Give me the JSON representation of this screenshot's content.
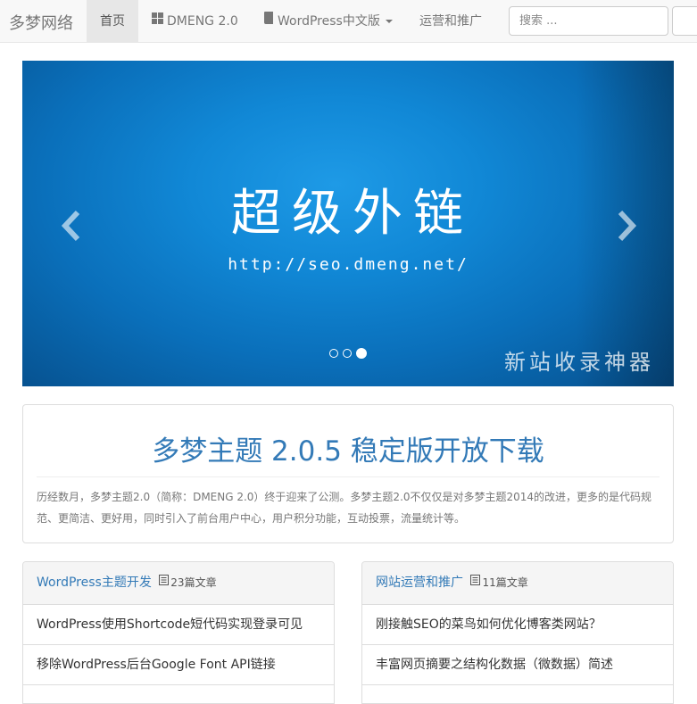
{
  "navbar": {
    "brand": "多梦网络",
    "items": [
      {
        "label": "首页",
        "icon": "none"
      },
      {
        "label": "DMENG 2.0",
        "icon": "th-large-icon"
      },
      {
        "label": "WordPress中文版",
        "icon": "book-icon"
      },
      {
        "label": "运营和推广",
        "icon": "none"
      }
    ],
    "search_placeholder": "搜索 ..."
  },
  "carousel": {
    "title": "超级外链",
    "subtitle": "http://seo.dmeng.net/",
    "caption": "新站收录神器",
    "slide_count": 3,
    "active_slide": 3
  },
  "notice": {
    "title": "多梦主题 2.0.5 稳定版开放下载",
    "text": "历经数月，多梦主题2.0（简称：DMENG 2.0）终于迎来了公测。多梦主题2.0不仅仅是对多梦主题2014的改进，更多的是代码规范、更简洁、更好用，同时引入了前台用户中心，用户积分功能，互动投票，流量统计等。"
  },
  "categories": [
    {
      "name": "WordPress主题开发",
      "count": "23篇文章",
      "posts": [
        "WordPress使用Shortcode短代码实现登录可见",
        "移除WordPress后台Google Font API链接"
      ]
    },
    {
      "name": "网站运营和推广",
      "count": "11篇文章",
      "posts": [
        "刚接触SEO的菜鸟如何优化博客类网站？",
        "丰富网页摘要之结构化数据（微数据）简述"
      ]
    }
  ],
  "colors": {
    "link": "#337ab7",
    "navbar_bg": "#f8f8f8",
    "slide_blue": "#1188d6"
  }
}
